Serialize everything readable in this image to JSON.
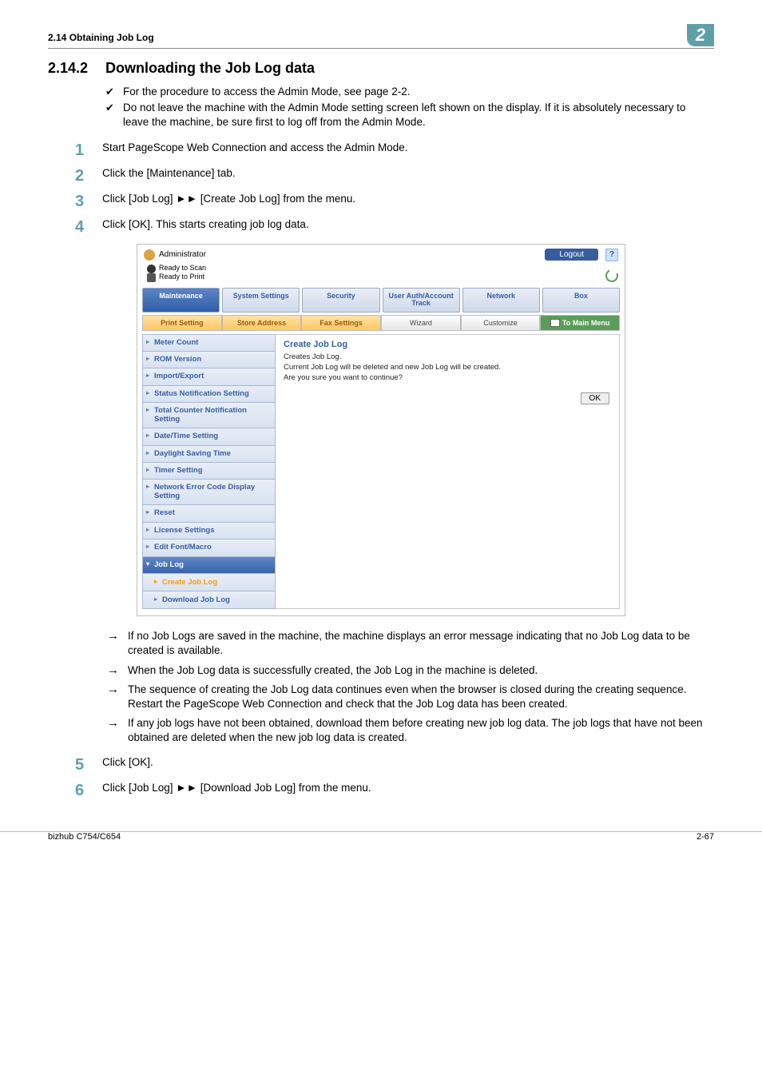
{
  "header": {
    "breadcrumb": "2.14    Obtaining Job Log",
    "badge": "2"
  },
  "section": {
    "number": "2.14.2",
    "title": "Downloading the Job Log data"
  },
  "checks": [
    "For the procedure to access the Admin Mode, see page 2-2.",
    "Do not leave the machine with the Admin Mode setting screen left shown on the display. If it is absolutely necessary to leave the machine, be sure first to log off from the Admin Mode."
  ],
  "steps": {
    "s1": "Start PageScope Web Connection and access the Admin Mode.",
    "s2": "Click the [Maintenance] tab.",
    "s3": "Click [Job Log] ►► [Create Job Log] from the menu.",
    "s4": "Click [OK]. This starts creating job log data.",
    "s5": "Click [OK].",
    "s6": "Click [Job Log] ►► [Download Job Log] from the menu."
  },
  "arrows": [
    "If no Job Logs are saved in the machine, the machine displays an error message indicating that no Job Log data to be created is available.",
    "When the Job Log data is successfully created, the Job Log in the machine is deleted.",
    "The sequence of creating the Job Log data continues even when the browser is closed during the creating sequence. Restart the PageScope Web Connection and check that the Job Log data has been created.",
    "If any job logs have not been obtained, download them before creating new job log data. The job logs that have not been obtained are deleted when the new job log data is created."
  ],
  "shot": {
    "admin": "Administrator",
    "logout": "Logout",
    "ready_scan": "Ready to Scan",
    "ready_print": "Ready to Print",
    "tabs": [
      "Maintenance",
      "System Settings",
      "Security",
      "User Auth/Account Track",
      "Network",
      "Box"
    ],
    "tabs2": [
      "Print Setting",
      "Store Address",
      "Fax Settings",
      "Wizard",
      "Customize"
    ],
    "to_main": "To Main Menu",
    "nav": [
      "Meter Count",
      "ROM Version",
      "Import/Export",
      "Status Notification Setting",
      "Total Counter Notification Setting",
      "Date/Time Setting",
      "Daylight Saving Time",
      "Timer Setting",
      "Network Error Code Display Setting",
      "Reset",
      "License Settings",
      "Edit Font/Macro"
    ],
    "nav_active": "Job Log",
    "nav_sub": [
      "Create Job Log",
      "Download Job Log"
    ],
    "main_title": "Create Job Log",
    "main_l1": "Creates Job Log.",
    "main_l2": "Current Job Log will be deleted and new Job Log will be created.",
    "main_l3": "Are you sure you want to continue?",
    "ok": "OK"
  },
  "footer": {
    "left": "bizhub C754/C654",
    "right": "2-67"
  }
}
